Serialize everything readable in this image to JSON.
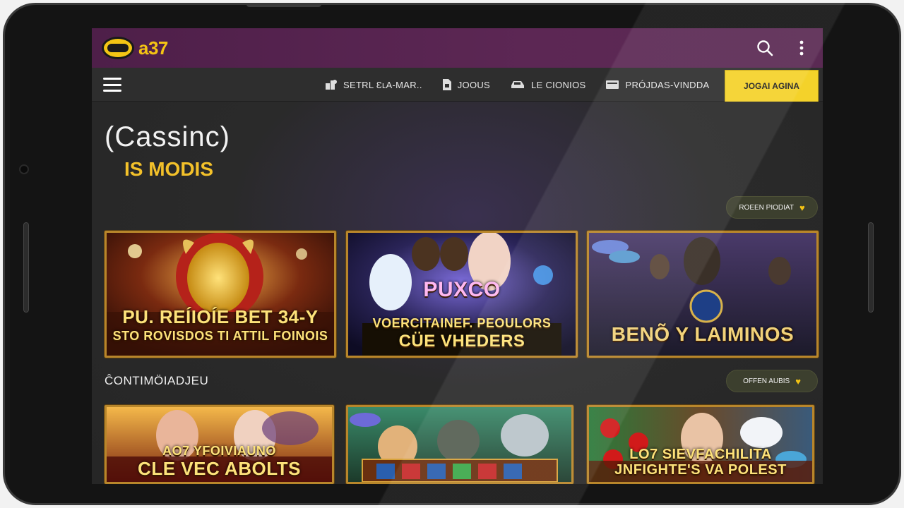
{
  "brand": {
    "logo_text": "a37",
    "accent": "#f4c414",
    "header_bg": "#5a2652"
  },
  "header": {
    "icons": [
      "search-icon",
      "more-vertical-icon"
    ]
  },
  "nav": {
    "menu_icon": "hamburger-icon",
    "links": [
      {
        "label": "SETRL ƐʟA-MAR..",
        "icon": "chips-icon"
      },
      {
        "label": "JOOUS",
        "icon": "card-icon"
      },
      {
        "label": "LE CIONIOS",
        "icon": "car-icon"
      },
      {
        "label": "PRÓJDAS-VINDDA",
        "icon": "ticket-icon"
      }
    ],
    "cta_label": "JOGAI AGINA"
  },
  "hero": {
    "title": "(Cassinc)",
    "subtitle": "IS MODIS"
  },
  "section1": {
    "pill_label": "ROEEN PIODIAT",
    "cards": [
      {
        "caption_line1": "PU. REÍIOÍE BET 34-Y",
        "caption_line2": "STO ROVISDOS TI ATTIL FOINOIS"
      },
      {
        "caption_top": "PUXCO",
        "caption_line1": "VOERCITAINEF. PEOULORS",
        "caption_line2": "CÜE VHEDERS"
      },
      {
        "caption_line1": "BENÕ Y LAIMINOS"
      }
    ]
  },
  "section2": {
    "title": "ĈONTIMÖIADJEU",
    "pill_label": "OFFEN AUBIS",
    "cards": [
      {
        "caption_line1": "AO7 YFOIVIAUNO",
        "caption_line2": "CLE VEC ABOLTS"
      },
      {
        "caption_line1": ""
      },
      {
        "caption_line1": "LO7 SIEVFACHILITA",
        "caption_line2": "JNFIGHTE'S VA POLEST"
      }
    ]
  }
}
